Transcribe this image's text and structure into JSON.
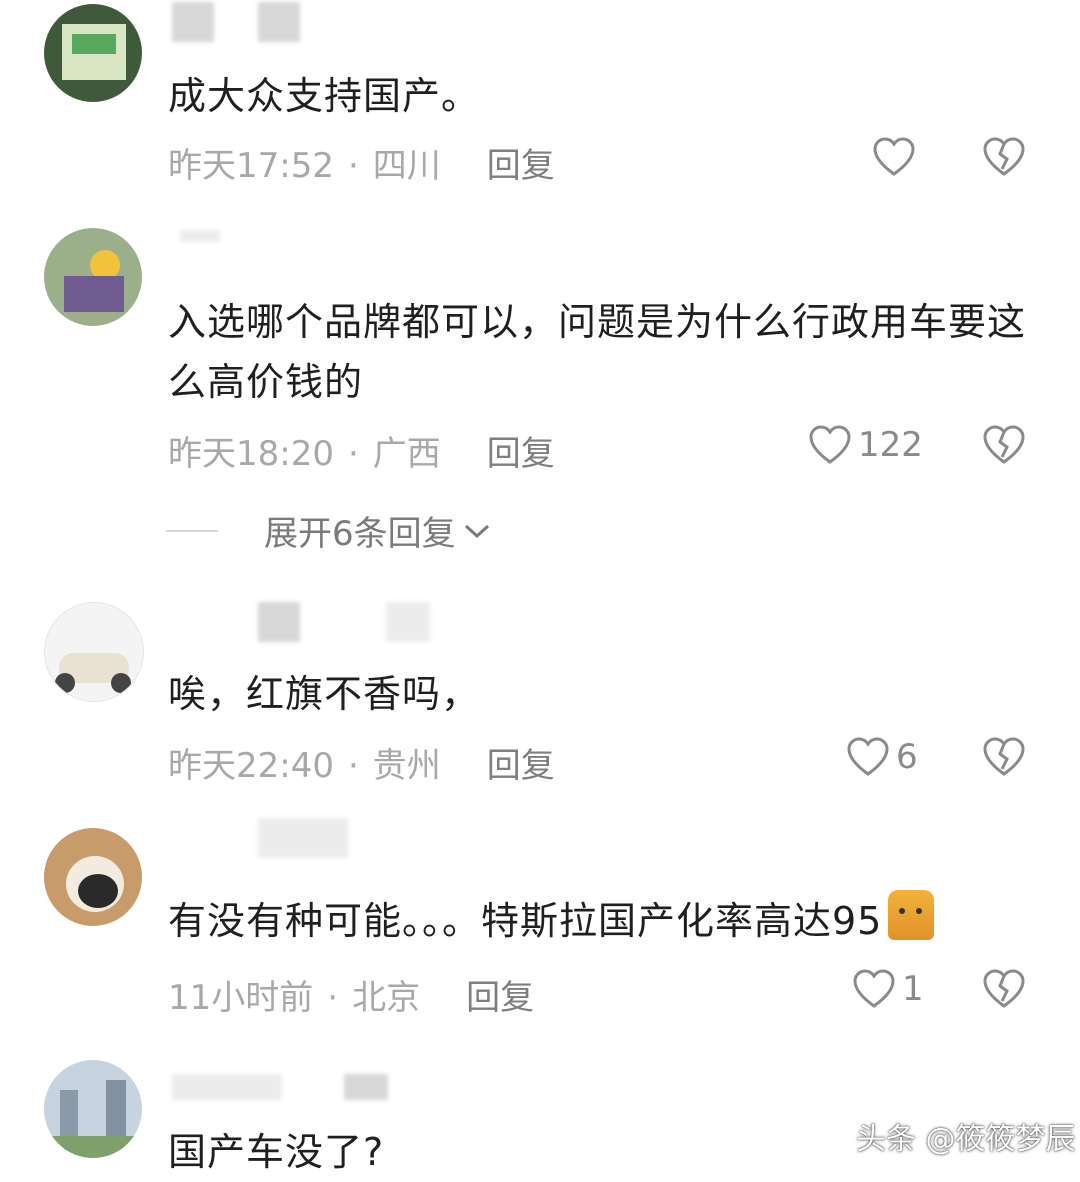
{
  "comments": [
    {
      "text": "成大众支持国产。",
      "time": "昨天17:52",
      "location": "四川",
      "reply": "回复",
      "likes": ""
    },
    {
      "text": "入选哪个品牌都可以，问题是为什么行政用车要这么高价钱的",
      "time": "昨天18:20",
      "location": "广西",
      "reply": "回复",
      "likes": "122"
    },
    {
      "text": "唉，红旗不香吗，",
      "time": "昨天22:40",
      "location": "贵州",
      "reply": "回复",
      "likes": "6"
    },
    {
      "text": "有没有种可能。。。特斯拉国产化率高达95",
      "time": "11小时前",
      "location": "北京",
      "reply": "回复",
      "likes": "1"
    },
    {
      "text": "国产车没了?",
      "time": "",
      "location": "",
      "reply": "",
      "likes": ""
    }
  ],
  "expand_replies": "展开6条回复",
  "separator": "·",
  "watermark": "头条 @筱筱梦辰",
  "colors": {
    "meta": "#a8a8a8",
    "icon": "#8a8a8a",
    "text": "#1f1f1f"
  }
}
